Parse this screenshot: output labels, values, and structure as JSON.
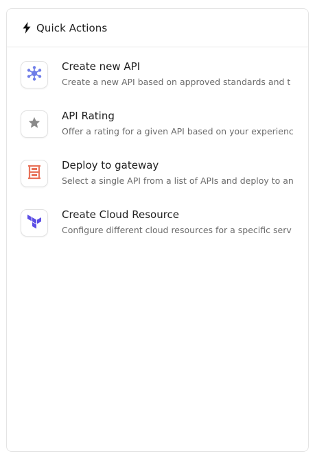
{
  "header": {
    "title": "Quick Actions",
    "icon": "lightning-bolt-icon"
  },
  "actions": [
    {
      "title": "Create new API",
      "description": "Create a new API based on approved standards and t",
      "icon": "hub-network-icon",
      "icon_color": "#6f7de8"
    },
    {
      "title": "API Rating",
      "description": "Offer a rating for a given API based on your experienc",
      "icon": "star-icon",
      "icon_color": "#8a8a8a"
    },
    {
      "title": "Deploy to gateway",
      "description": "Select a single API from a list of APIs and deploy to an",
      "icon": "gateway-icon",
      "icon_color": "#e8735a"
    },
    {
      "title": "Create Cloud Resource",
      "description": "Configure different cloud resources for a specific serv",
      "icon": "terraform-icon",
      "icon_color": "#5c4ee5"
    }
  ]
}
